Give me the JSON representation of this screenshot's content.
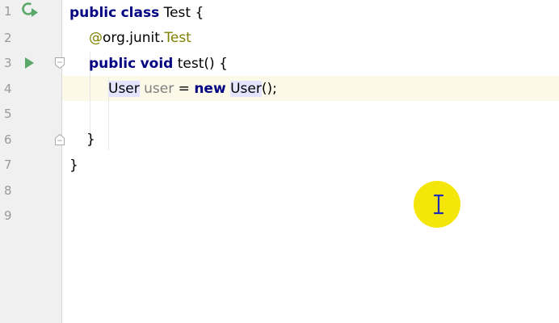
{
  "editor": {
    "line_numbers": [
      "1",
      "2",
      "3",
      "4",
      "5",
      "6",
      "7",
      "8",
      "9"
    ],
    "lines": {
      "l1": {
        "kw1": "public",
        "kw2": "class",
        "rest": " Test {"
      },
      "l2": {
        "ann_prefix": "@",
        "pkg": "org.junit.",
        "ann_name": "Test"
      },
      "l3": {
        "kw1": "public",
        "kw2": "void",
        "rest": " test() {"
      },
      "l4": {
        "type1": "User",
        "var": "user",
        "eq": " = ",
        "kw": "new",
        "type2": "User",
        "rest": "();"
      },
      "l6": {
        "text": "}"
      },
      "l7": {
        "text": "}"
      }
    },
    "icons": {
      "run_class": "run-class-icon",
      "run_method": "run-method-icon",
      "fold_open": "fold-open-icon",
      "fold_close": "fold-close-icon",
      "text_cursor": "ibeam-cursor-icon"
    },
    "colors": {
      "keyword": "#000080",
      "annotation": "#808000",
      "unused_variable": "#808080",
      "current_line": "#fcf9e8",
      "usage_highlight": "#e4e4ff",
      "run_icon": "#59a869",
      "cursor_highlight": "#f5e60a"
    }
  }
}
